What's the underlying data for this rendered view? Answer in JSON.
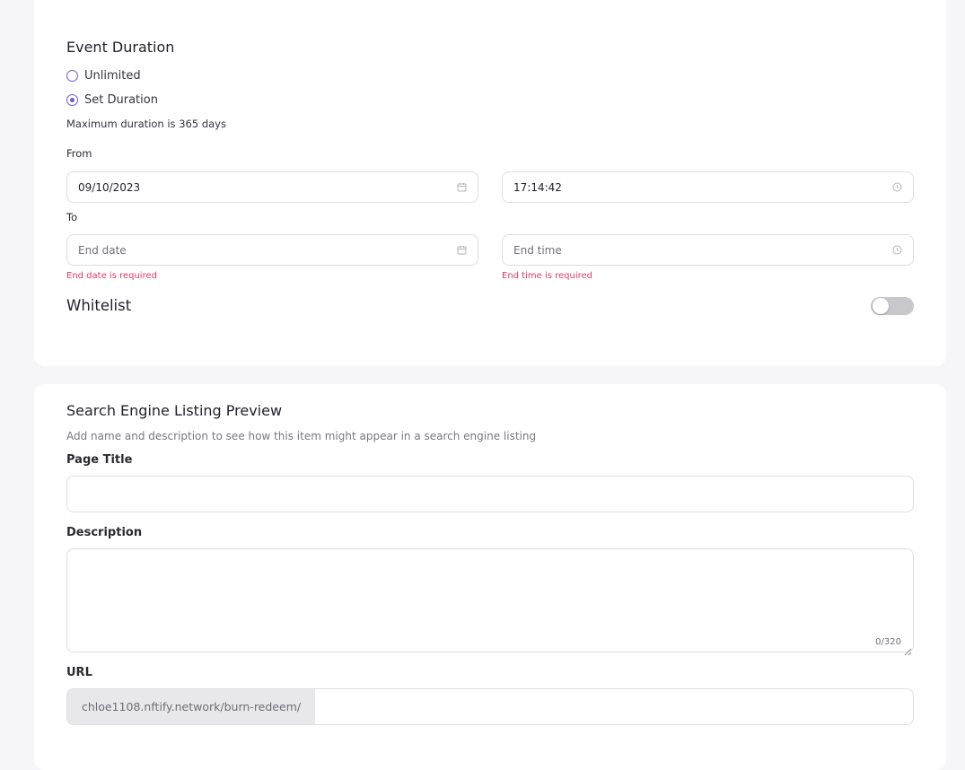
{
  "duration": {
    "title": "Event Duration",
    "options": [
      {
        "label": "Unlimited",
        "checked": false
      },
      {
        "label": "Set Duration",
        "checked": true
      }
    ],
    "note": "Maximum duration is 365 days",
    "from_label": "From",
    "to_label": "To",
    "start_date": "09/10/2023",
    "start_time": "17:14:42",
    "end_date_placeholder": "End date",
    "end_time_placeholder": "End time",
    "end_date_error": "End date is required",
    "end_time_error": "End time is required"
  },
  "whitelist": {
    "label": "Whitelist",
    "enabled": false
  },
  "seo": {
    "title": "Search Engine Listing Preview",
    "subtitle": "Add name and description to see how this item might appear in a search engine listing",
    "page_title_label": "Page Title",
    "page_title_value": "",
    "description_label": "Description",
    "description_value": "",
    "char_count": "0/320",
    "url_label": "URL",
    "url_prefix": "chloe1108.nftify.network/burn-redeem/",
    "url_value": ""
  },
  "colors": {
    "accent": "#6d5bd0",
    "error": "#e23d5c",
    "toggle_off": "#c7c7cc"
  },
  "icons": {
    "date": "calendar-icon",
    "time": "clock-icon",
    "resize": "resize-handle-icon"
  }
}
